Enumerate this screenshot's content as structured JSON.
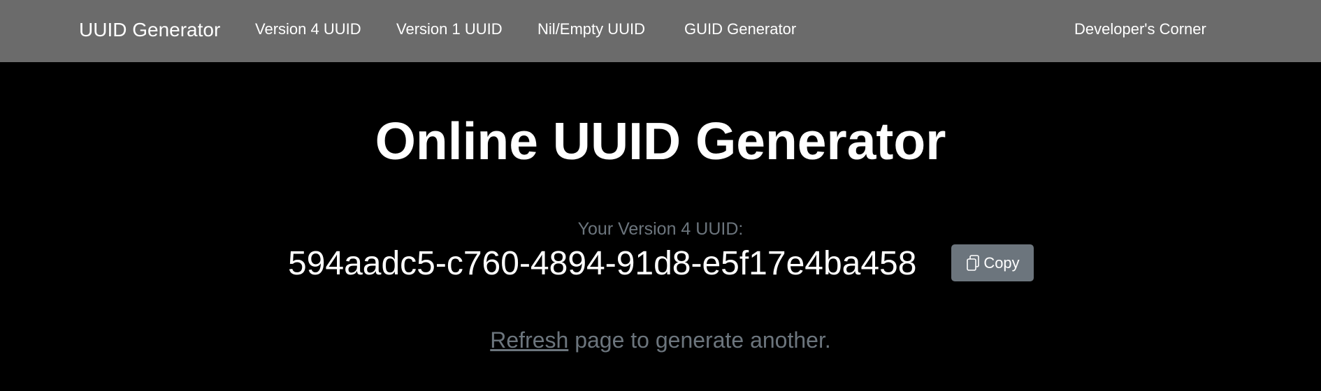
{
  "navbar": {
    "brand": "UUID Generator",
    "links": [
      "Version 4 UUID",
      "Version 1 UUID",
      "Nil/Empty UUID",
      "GUID Generator"
    ],
    "right_link": "Developer's Corner"
  },
  "main": {
    "title": "Online UUID Generator",
    "uuid_label": "Your Version 4 UUID:",
    "uuid_value": "594aadc5-c760-4894-91d8-e5f17e4ba458",
    "copy_label": "Copy",
    "refresh_link": "Refresh",
    "refresh_rest": " page to generate another."
  },
  "colors": {
    "navbar_bg": "#6b6b6b",
    "page_bg": "#000000",
    "muted_text": "#6c757d",
    "button_bg": "#6c757d"
  },
  "icons": {
    "copy": "clipboard-copy-icon"
  }
}
